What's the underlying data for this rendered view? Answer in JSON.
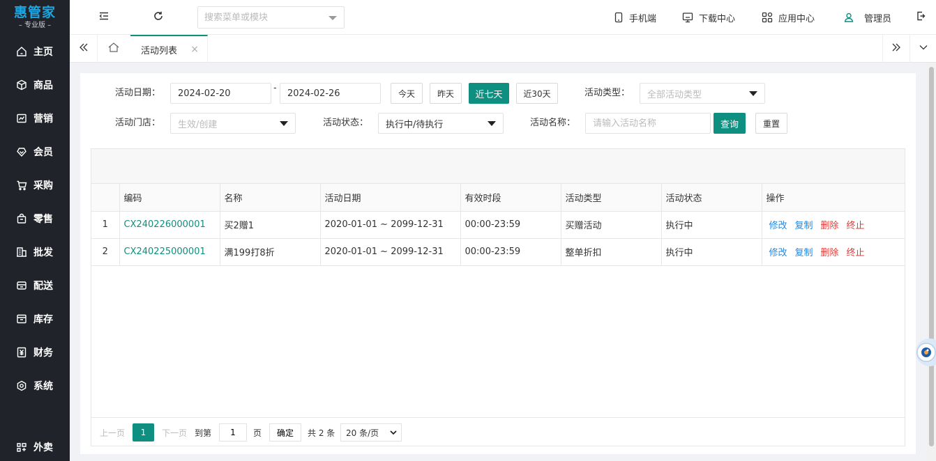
{
  "brand": {
    "name": "惠管家",
    "edition": "– 专业版 –"
  },
  "sidebar": {
    "items": [
      {
        "label": "主页",
        "icon": "home-icon"
      },
      {
        "label": "商品",
        "icon": "box-icon"
      },
      {
        "label": "营销",
        "icon": "chart-icon"
      },
      {
        "label": "会员",
        "icon": "heart-diamond-icon"
      },
      {
        "label": "采购",
        "icon": "cart-icon"
      },
      {
        "label": "零售",
        "icon": "bag-icon"
      },
      {
        "label": "批发",
        "icon": "building-icon"
      },
      {
        "label": "配送",
        "icon": "delivery-icon"
      },
      {
        "label": "库存",
        "icon": "storage-icon"
      },
      {
        "label": "财务",
        "icon": "yen-icon"
      },
      {
        "label": "系统",
        "icon": "settings-icon"
      },
      {
        "label": "外卖",
        "icon": "takeout-icon"
      }
    ]
  },
  "header": {
    "search_placeholder": "搜索菜单或模块",
    "mobile": "手机端",
    "download": "下载中心",
    "apps": "应用中心",
    "user": "管理员"
  },
  "tabs": {
    "active": "活动列表",
    "close": "×"
  },
  "filters": {
    "date_label": "活动日期：",
    "date_start": "2024-02-20",
    "date_sep": "-",
    "date_end": "2024-02-26",
    "today": "今天",
    "yesterday": "昨天",
    "last7": "近七天",
    "last30": "近30天",
    "type_label": "活动类型：",
    "type_value": "全部活动类型",
    "store_label": "活动门店：",
    "store_value": "生效/创建",
    "status_label": "活动状态：",
    "status_value": "执行中/待执行",
    "name_label": "活动名称：",
    "name_placeholder": "请输入活动名称",
    "query": "查询",
    "reset": "重置"
  },
  "table": {
    "columns": [
      "编码",
      "名称",
      "活动日期",
      "有效时段",
      "活动类型",
      "活动状态",
      "操作"
    ],
    "rows": [
      {
        "num": "1",
        "code": "CX240226000001",
        "name": "买2赠1",
        "date": "2020-01-01 ~ 2099-12-31",
        "period": "00:00-23:59",
        "type": "买赠活动",
        "status": "执行中"
      },
      {
        "num": "2",
        "code": "CX240225000001",
        "name": "满199打8折",
        "date": "2020-01-01 ~ 2099-12-31",
        "period": "00:00-23:59",
        "type": "整单折扣",
        "status": "执行中"
      }
    ],
    "ops": {
      "edit": "修改",
      "copy": "复制",
      "delete": "删除",
      "stop": "终止"
    }
  },
  "pager": {
    "prev": "上一页",
    "current": "1",
    "next": "下一页",
    "goto": "到第",
    "goto_value": "1",
    "page_unit": "页",
    "confirm": "确定",
    "total": "共 2 条",
    "per_page": "20 条/页"
  },
  "colors": {
    "accent": "#0e8f80",
    "sidebar": "#20232a",
    "link_blue": "#1e88e5",
    "danger": "#e53935"
  }
}
